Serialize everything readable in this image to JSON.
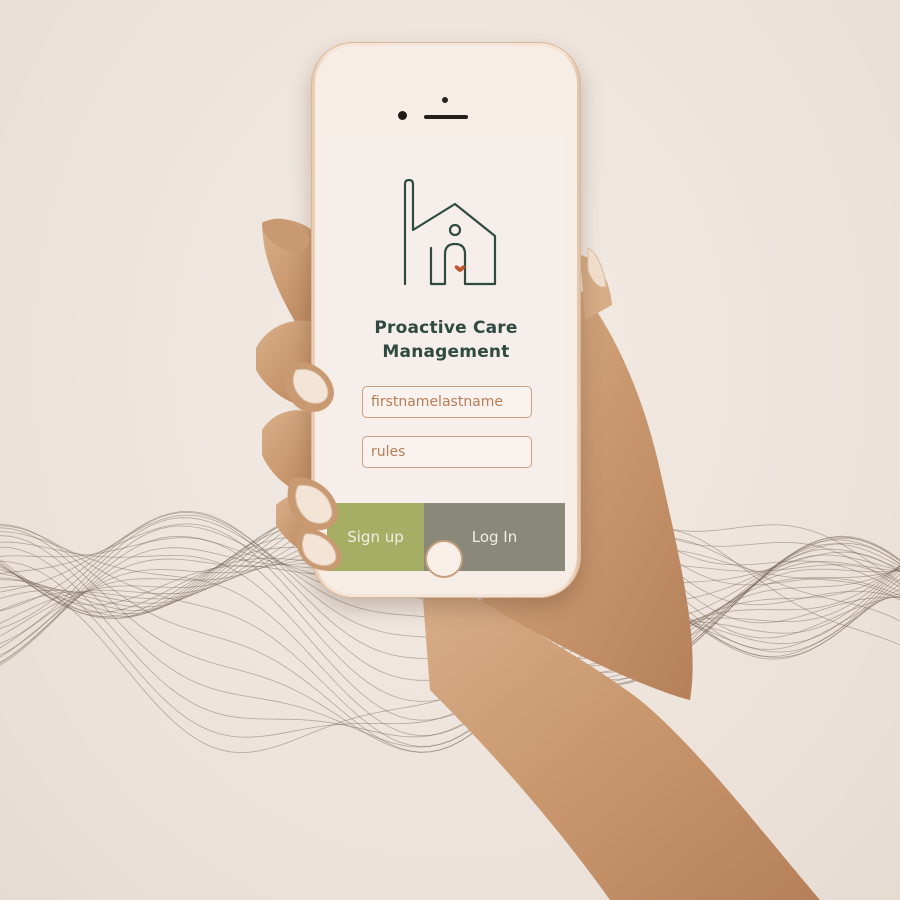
{
  "app": {
    "title_line1": "Proactive Care",
    "title_line2": "Management",
    "logo_icon": "house-with-person-heart-icon"
  },
  "login_form": {
    "username_value": "firstnamelastname",
    "password_value": "rules",
    "signup_label": "Sign up",
    "login_label": "Log In"
  },
  "colors": {
    "background": "#efe5de",
    "title": "#2f4a43",
    "field_text": "#b77e56",
    "field_border": "#c9a083",
    "signup_button": "#a6ad64",
    "login_button": "#8a8979",
    "heart": "#c0552e",
    "phone_frame": "#f4e6dc"
  }
}
